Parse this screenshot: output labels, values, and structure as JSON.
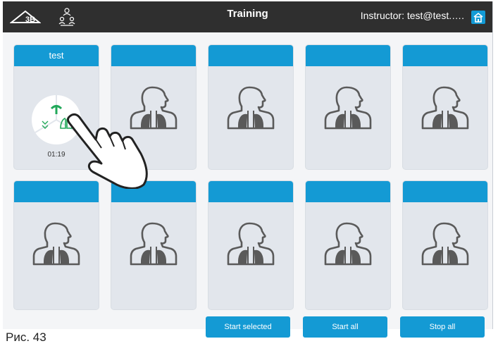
{
  "header": {
    "title": "Training",
    "instructor": "Instructor: test@test.….",
    "logo_icon": "3b-logo-icon",
    "users_icon": "users-network-icon",
    "home_icon": "home-icon"
  },
  "stations": [
    {
      "name": "test",
      "timer": "01:19",
      "state": "active"
    },
    {
      "name": "",
      "state": "empty"
    },
    {
      "name": "",
      "state": "empty"
    },
    {
      "name": "",
      "state": "empty"
    },
    {
      "name": "",
      "state": "empty"
    },
    {
      "name": "",
      "state": "empty"
    },
    {
      "name": "",
      "state": "empty"
    },
    {
      "name": "",
      "state": "empty"
    },
    {
      "name": "",
      "state": "empty"
    },
    {
      "name": "",
      "state": "empty"
    }
  ],
  "actions": {
    "start_selected": "Start selected",
    "start_all": "Start all",
    "stop_all": "Stop all"
  },
  "caption": "Рис. 43",
  "colors": {
    "topbar": "#2f2f2f",
    "accent": "#149ad4",
    "card": "#e2e6ec",
    "wheel_green": "#22a85a"
  }
}
